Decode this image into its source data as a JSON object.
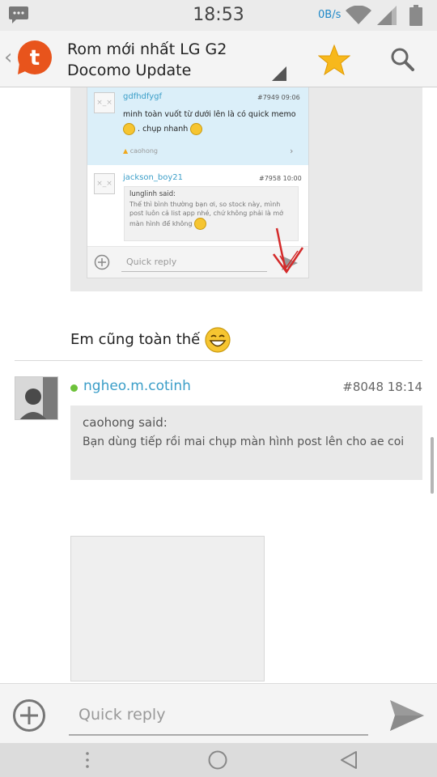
{
  "status_bar": {
    "time": "18:53",
    "net_speed": "0B/s",
    "icons": [
      "notification-icon",
      "wifi-icon",
      "signal-icon",
      "battery-icon"
    ]
  },
  "action_bar": {
    "title_line1": "Rom mới nhất LG G2",
    "title_line2": "Docomo Update",
    "icons": [
      "back-chevron-icon",
      "app-logo-icon",
      "dropdown-icon",
      "star-icon",
      "search-icon"
    ],
    "logo_letter": "t",
    "star_color": "#f7b81c",
    "accent_color": "#e8541c"
  },
  "quoted_screenshot": {
    "post1": {
      "user": "gdfhdfygf",
      "meta": "#7949 09:06",
      "text_line1": "minh toàn vuốt từ dưới lên là có quick memo",
      "text_line2": ". chụp nhanh",
      "like_user": "caohong"
    },
    "post2": {
      "user": "jackson_boy21",
      "meta": "#7958 10:00",
      "quote_user": "lunglinh said:",
      "quote_text": "Thế thì bình thường bạn ơi, so stock này, mình post luôn cả list app nhé, chứ không phải là mớ màn hình để không"
    },
    "quick_reply_placeholder": "Quick reply"
  },
  "post_text": "Em cũng toàn thế",
  "post": {
    "user": "ngheo.m.cotinh",
    "number_time": "#8048 18:14",
    "quote_user": "caohong said:",
    "quote_text": "Bạn dùng tiếp rồi mai chụp màn hình post lên cho ae coi",
    "online_color": "#6dc23a"
  },
  "quick_reply": {
    "placeholder": "Quick reply",
    "icons": [
      "add-icon",
      "send-icon"
    ]
  },
  "nav_bar": {
    "icons": [
      "menu-icon",
      "home-icon",
      "back-icon"
    ]
  },
  "colors": {
    "link": "#3b9ec8",
    "quote_bg": "#e9e9e9",
    "inner_highlight": "#dbeff9"
  }
}
